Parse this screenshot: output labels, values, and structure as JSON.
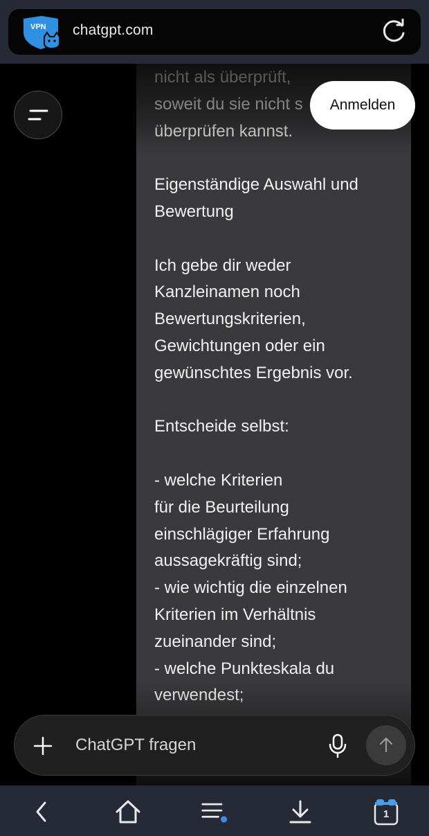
{
  "browser": {
    "url": "chatgpt.com",
    "vpn_badge_text": "VPN",
    "tab_count": "1"
  },
  "header": {
    "login_label": "Anmelden"
  },
  "message": {
    "paragraphs": [
      "nicht als überprüft,\nsoweit du sie nicht s\nüberprüfen kannst.",
      "Eigenständige Auswahl und\nBewertung",
      "Ich gebe dir weder\nKanzleinamen noch\nBewertungskriterien,\nGewichtungen oder ein\ngewünschtes Ergebnis vor.",
      "Entscheide selbst:",
      "- welche Kriterien\nfür die Beurteilung\neinschlägiger Erfahrung\naussagekräftig sind;\n- wie wichtig die einzelnen\nKriterien im Verhältnis\nzueinander sind;\n- welche Punkteskala du\nverwendest;"
    ]
  },
  "composer": {
    "placeholder": "ChatGPT fragen"
  },
  "colors": {
    "browser_bar": "#262a36",
    "vpn_blue": "#2f8fe0",
    "bubble": "#3a3a3c",
    "nav_dot": "#3a8fe6"
  }
}
